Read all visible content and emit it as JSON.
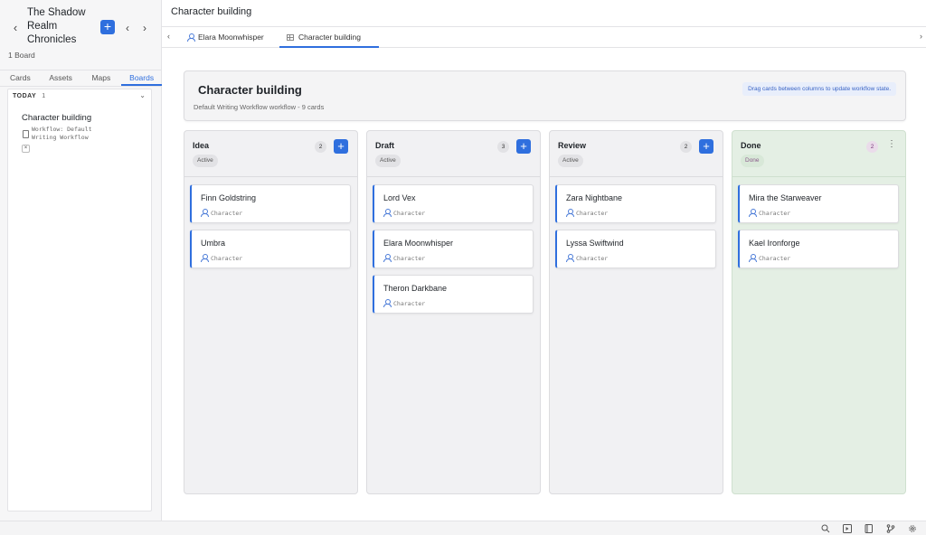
{
  "sidebar": {
    "project_title": "The Shadow Realm Chronicles",
    "board_count": "1 Board",
    "tabs": [
      {
        "label": "Cards"
      },
      {
        "label": "Assets"
      },
      {
        "label": "Maps"
      },
      {
        "label": "Boards",
        "active": true
      }
    ],
    "group": {
      "label": "TODAY",
      "count": "1",
      "item": {
        "title": "Character building",
        "subtitle": "Workflow: Default Writing Workflow"
      }
    }
  },
  "main": {
    "title": "Character building",
    "tabs": [
      {
        "label": "Elara Moonwhisper",
        "icon": "person-icon"
      },
      {
        "label": "Character building",
        "icon": "table-icon",
        "active": true
      }
    ]
  },
  "board": {
    "title": "Character building",
    "subtitle": "Default Writing Workflow workflow - 9 cards",
    "hint": "Drag cards between columns to update workflow state.",
    "columns": [
      {
        "title": "Idea",
        "status": "Active",
        "count": "2",
        "cards": [
          {
            "title": "Finn Goldstring",
            "type": "Character"
          },
          {
            "title": "Umbra",
            "type": "Character"
          }
        ]
      },
      {
        "title": "Draft",
        "status": "Active",
        "count": "3",
        "cards": [
          {
            "title": "Lord Vex",
            "type": "Character"
          },
          {
            "title": "Elara Moonwhisper",
            "type": "Character"
          },
          {
            "title": "Theron Darkbane",
            "type": "Character"
          }
        ]
      },
      {
        "title": "Review",
        "status": "Active",
        "count": "2",
        "cards": [
          {
            "title": "Zara Nightbane",
            "type": "Character"
          },
          {
            "title": "Lyssa Swiftwind",
            "type": "Character"
          }
        ]
      },
      {
        "title": "Done",
        "status": "Done",
        "count": "2",
        "cards": [
          {
            "title": "Mira the Starweaver",
            "type": "Character"
          },
          {
            "title": "Kael Ironforge",
            "type": "Character"
          }
        ]
      }
    ]
  },
  "colors": {
    "accent": "#2f6fde",
    "done_column": "#e4efe4"
  },
  "statusbar_icons": [
    "search-icon",
    "play-icon",
    "book-icon",
    "git-branch-icon",
    "gear-icon"
  ]
}
